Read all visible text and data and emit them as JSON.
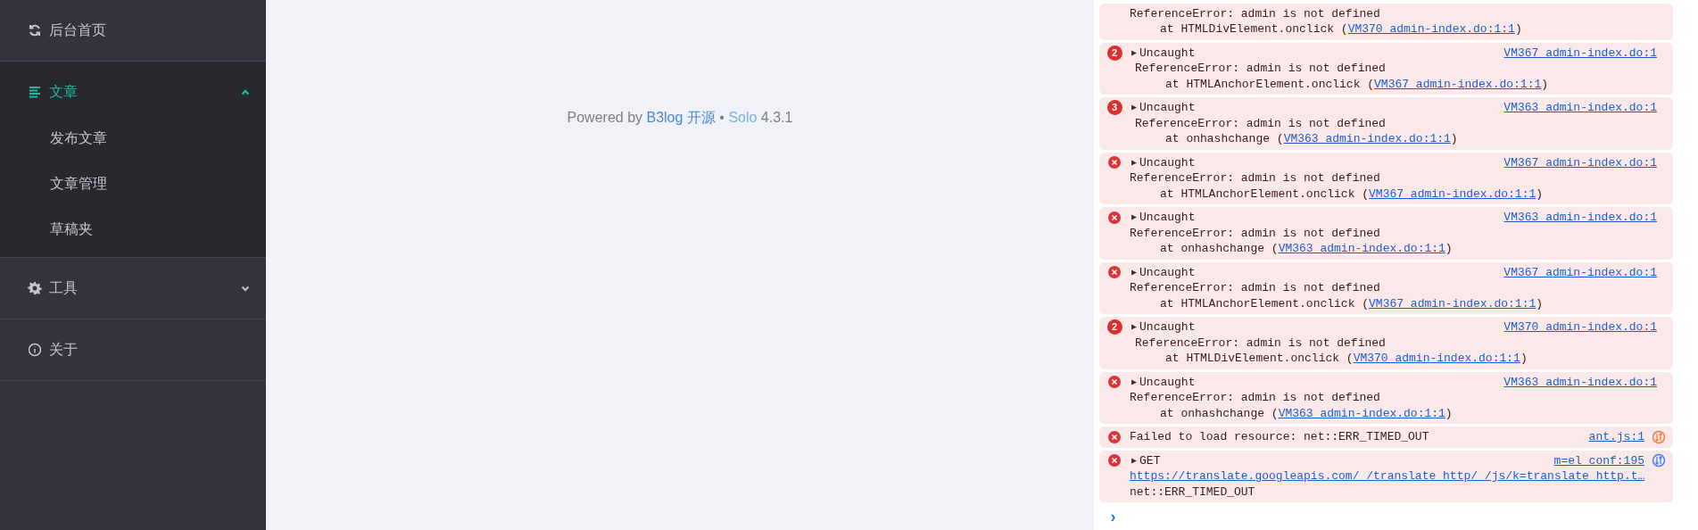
{
  "sidebar": {
    "items": [
      {
        "label": "后台首页",
        "kind": "refresh",
        "selected": false
      },
      {
        "label": "文章",
        "kind": "list",
        "expanded": true,
        "selected": true,
        "children": [
          {
            "label": "发布文章"
          },
          {
            "label": "文章管理"
          },
          {
            "label": "草稿夹"
          }
        ]
      },
      {
        "label": "工具",
        "kind": "gear",
        "expanded": false,
        "selected": false
      },
      {
        "label": "关于",
        "kind": "info",
        "selected": false
      }
    ]
  },
  "footer": {
    "prefix": "Powered by",
    "link": "B3log 开源",
    "separator": "•",
    "product": "Solo",
    "version": "4.3.1"
  },
  "console": {
    "entries": [
      {
        "kind": "continuation",
        "lines": [
          {
            "kind": "message",
            "text": "ReferenceError: admin is not defined"
          },
          {
            "kind": "stack",
            "text": "at HTMLDivElement.onclick (",
            "link": "VM370_admin-index.do:1:1",
            "suffix": ")"
          }
        ]
      },
      {
        "kind": "count",
        "count": "2",
        "expander": "▶",
        "summary": "Uncaught",
        "source": "VM367_admin-index.do:1",
        "lines": [
          {
            "kind": "message",
            "text": "ReferenceError: admin is not defined"
          },
          {
            "kind": "stack",
            "text": "at HTMLAnchorElement.onclick (",
            "link": "VM367_admin-index.do:1:1",
            "suffix": ")"
          }
        ]
      },
      {
        "kind": "count",
        "count": "3",
        "expander": "▶",
        "summary": "Uncaught",
        "source": "VM363_admin-index.do:1",
        "lines": [
          {
            "kind": "message",
            "text": "ReferenceError: admin is not defined"
          },
          {
            "kind": "stack",
            "text": "at onhashchange (",
            "link": "VM363_admin-index.do:1:1",
            "suffix": ")"
          }
        ]
      },
      {
        "kind": "error",
        "expander": "▶",
        "summary": "Uncaught",
        "source": "VM367_admin-index.do:1",
        "lines": [
          {
            "kind": "message",
            "text": "ReferenceError: admin is not defined"
          },
          {
            "kind": "stack",
            "text": "at HTMLAnchorElement.onclick (",
            "link": "VM367_admin-index.do:1:1",
            "suffix": ")"
          }
        ]
      },
      {
        "kind": "error",
        "expander": "▶",
        "summary": "Uncaught",
        "source": "VM363_admin-index.do:1",
        "lines": [
          {
            "kind": "message",
            "text": "ReferenceError: admin is not defined"
          },
          {
            "kind": "stack",
            "text": "at onhashchange (",
            "link": "VM363_admin-index.do:1:1",
            "suffix": ")"
          }
        ]
      },
      {
        "kind": "error",
        "expander": "▶",
        "summary": "Uncaught",
        "source": "VM367_admin-index.do:1",
        "lines": [
          {
            "kind": "message",
            "text": "ReferenceError: admin is not defined"
          },
          {
            "kind": "stack",
            "text": "at HTMLAnchorElement.onclick (",
            "link": "VM367_admin-index.do:1:1",
            "suffix": ")"
          }
        ]
      },
      {
        "kind": "count",
        "count": "2",
        "expander": "▶",
        "summary": "Uncaught",
        "source": "VM370_admin-index.do:1",
        "lines": [
          {
            "kind": "message",
            "text": "ReferenceError: admin is not defined"
          },
          {
            "kind": "stack",
            "text": "at HTMLDivElement.onclick (",
            "link": "VM370_admin-index.do:1:1",
            "suffix": ")"
          }
        ]
      },
      {
        "kind": "error",
        "expander": "▶",
        "summary": "Uncaught",
        "source": "VM363_admin-index.do:1",
        "lines": [
          {
            "kind": "message",
            "text": "ReferenceError: admin is not defined"
          },
          {
            "kind": "stack",
            "text": "at onhashchange (",
            "link": "VM363_admin-index.do:1:1",
            "suffix": ")"
          }
        ]
      },
      {
        "kind": "error",
        "summary": "Failed to load resource: net::ERR_TIMED_OUT",
        "source": "ant.js:1",
        "source_icon": {
          "color": "#f0803c"
        }
      },
      {
        "kind": "error",
        "expander": "▶",
        "summary": "GET",
        "source": "m=el_conf:195",
        "source_icon": {
          "color": "#3b82f6"
        },
        "lines": [
          {
            "kind": "url",
            "link": "https://translate.googleapis.com/_/translate_http/_/js/k=translate_http.t…"
          },
          {
            "kind": "message",
            "text": "net::ERR_TIMED_OUT"
          }
        ]
      }
    ],
    "prompt": "›"
  }
}
